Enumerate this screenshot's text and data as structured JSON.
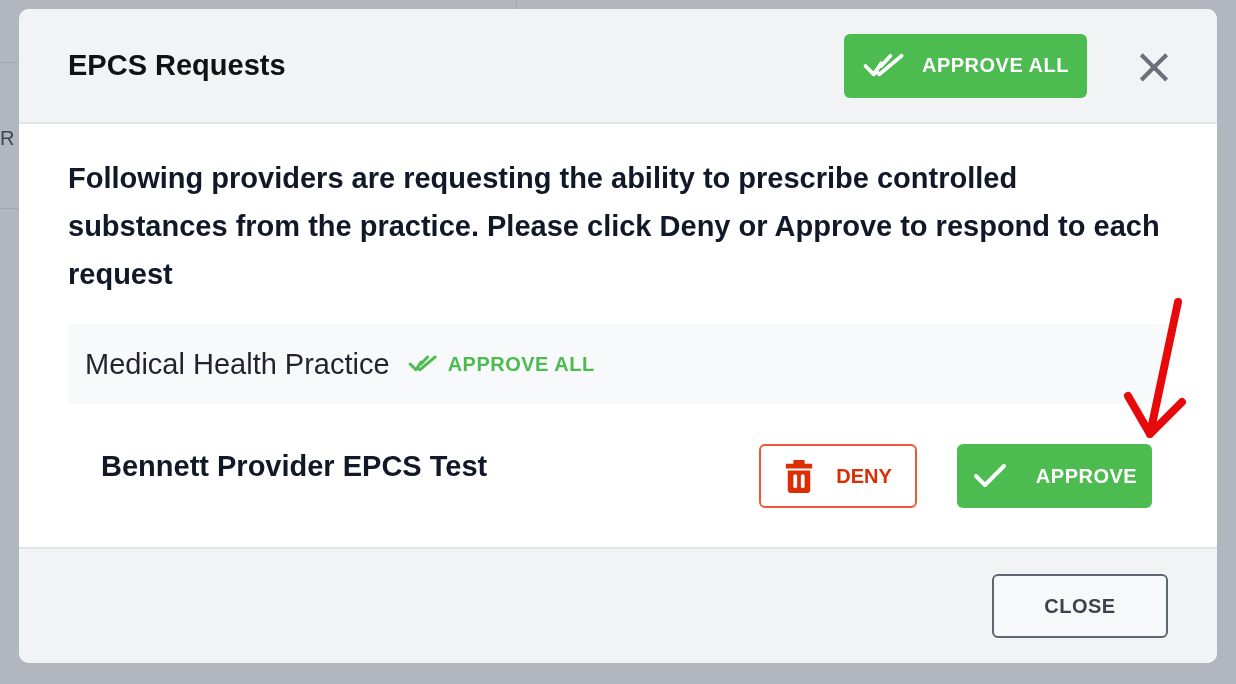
{
  "background": {
    "text": "R"
  },
  "dialog": {
    "title": "EPCS Requests",
    "approve_all_button": "APPROVE ALL",
    "close_icon": "×",
    "message": "Following providers are requesting the ability to prescribe controlled substances from the practice. Please click Deny or Approve to respond to each request",
    "practices": [
      {
        "name": "Medical Health Practice",
        "approve_all_link": "APPROVE ALL",
        "providers": [
          {
            "name": "Bennett Provider EPCS Test",
            "deny_button": "DENY",
            "approve_button": "APPROVE"
          }
        ]
      }
    ],
    "footer_button": "CLOSE"
  }
}
